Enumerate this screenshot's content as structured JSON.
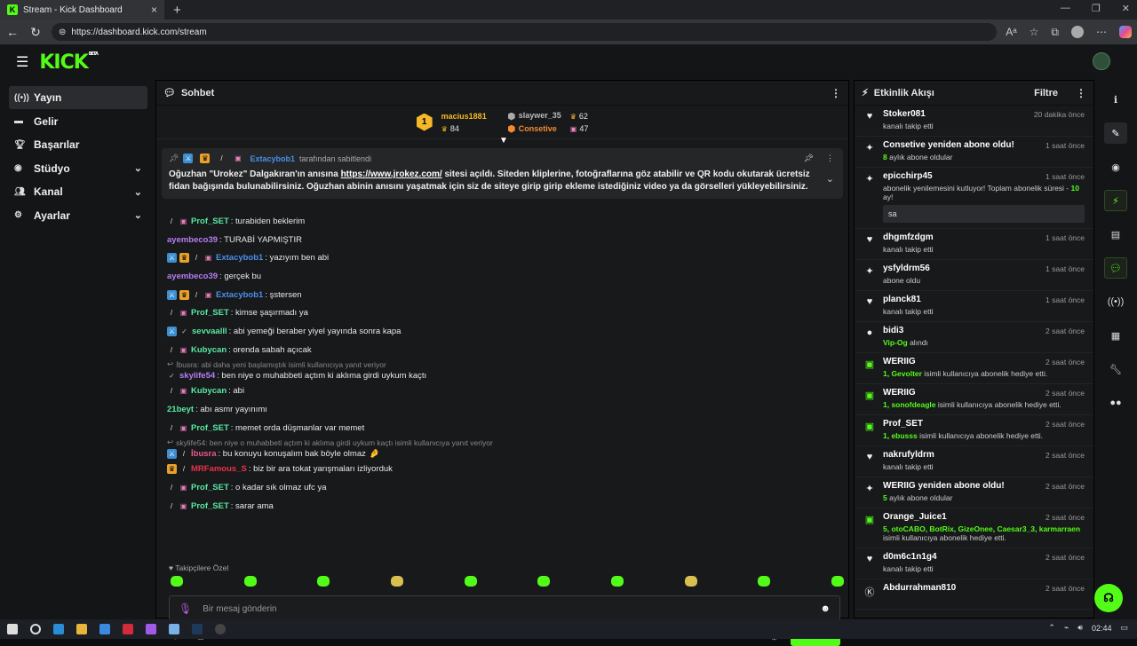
{
  "browser": {
    "tab_title": "Stream - Kick Dashboard",
    "url": "https://dashboard.kick.com/stream"
  },
  "app": {
    "logo": "KICK",
    "beta": "BETA"
  },
  "sidebar": {
    "items": [
      {
        "label": "Yayın",
        "icon": "broadcast-icon",
        "active": true
      },
      {
        "label": "Gelir",
        "icon": "money-icon"
      },
      {
        "label": "Başarılar",
        "icon": "trophy-icon"
      },
      {
        "label": "Stüdyo",
        "icon": "camera-icon",
        "chevron": true
      },
      {
        "label": "Kanal",
        "icon": "users-icon",
        "chevron": true
      },
      {
        "label": "Ayarlar",
        "icon": "gear-icon",
        "chevron": true
      }
    ]
  },
  "chat": {
    "title": "Sohbet",
    "leaderboard": {
      "first": {
        "rank": "1",
        "name": "macius1881",
        "gifts": "84"
      },
      "second": {
        "name": "slaywer_35",
        "gifts": "62"
      },
      "third": {
        "name": "Consetive",
        "gifts": "47"
      }
    },
    "pinned": {
      "pinner": "Extacybob1",
      "suffix": "tarafından sabitlendi",
      "text_before": "Oğuzhan \"Urokez\" Dalgakıran'ın anısına ",
      "link": "https://www.jrokez.com/",
      "text_after": " sitesi açıldı. Siteden kliplerine, fotoğraflarına göz atabilir ve QR kodu okutarak ücretsiz fidan bağışında bulunabilirsiniz. Oğuzhan abinin anısını yaşatmak için siz de siteye girip girip ekleme istediğiniz video ya da görselleri yükleyebilirsiniz."
    },
    "messages": [
      {
        "user": "Prof_SET",
        "color": "#58e8a2",
        "badges": [
          "sword",
          "gift"
        ],
        "text": ": turabiden beklerim"
      },
      {
        "user": "ayembeco39",
        "color": "#b57ef5",
        "badges": [],
        "text": ": TURABİ YAPMIŞTIR"
      },
      {
        "user": "Extacybob1",
        "color": "#4a8fe8",
        "badges": [
          "mod",
          "crown",
          "sword",
          "gift"
        ],
        "text": ": yazıyım ben abi"
      },
      {
        "user": "ayembeco39",
        "color": "#b57ef5",
        "badges": [],
        "text": ": gerçek bu"
      },
      {
        "user": "Extacybob1",
        "color": "#4a8fe8",
        "badges": [
          "mod",
          "crown",
          "sword",
          "gift"
        ],
        "text": ": şstersen"
      },
      {
        "user": "Prof_SET",
        "color": "#58e8a2",
        "badges": [
          "sword",
          "gift"
        ],
        "text": ": kimse şaşırmadı ya"
      },
      {
        "user": "sevvaalll",
        "color": "#58e8a2",
        "badges": [
          "mod",
          "check"
        ],
        "text": ": abi yemeği beraber yiyel yayında sonra kapa"
      },
      {
        "user": "Kubycan",
        "color": "#58e8a2",
        "badges": [
          "sword",
          "gift"
        ],
        "text": ": orenda sabah açıcak"
      },
      {
        "reply": "İbusra: abi daha yeni başlamıştık isimli kullanıcıya yanıt veriyor"
      },
      {
        "user": "skylife54",
        "color": "#b57ef5",
        "badges": [
          "check"
        ],
        "text": ": ben niye o muhabbeti açtım ki aklıma girdi uykum kaçtı"
      },
      {
        "user": "Kubycan",
        "color": "#58e8a2",
        "badges": [
          "sword",
          "gift"
        ],
        "text": ": abi"
      },
      {
        "user": "21beyt",
        "color": "#58e8a2",
        "badges": [],
        "text": ": abı asmr yayınımı"
      },
      {
        "user": "Prof_SET",
        "color": "#58e8a2",
        "badges": [
          "sword",
          "gift"
        ],
        "text": ": memet orda düşmanlar var memet"
      },
      {
        "reply": "skylife54: ben niye o muhabbeti açtım ki aklıma girdi uykum kaçtı isimli kullanıcıya yanıt veriyor"
      },
      {
        "user": "İbusra",
        "color": "#e85a86",
        "badges": [
          "mod",
          "sword"
        ],
        "text": ": bu konuyu konuşalım bak böyle olmaz",
        "emoji": "🤌"
      },
      {
        "user": "MRFamous_S",
        "color": "#e8324a",
        "badges": [
          "crown",
          "sword"
        ],
        "text": ": biz bir ara tokat yarışmaları izliyorduk"
      },
      {
        "user": "Prof_SET",
        "color": "#58e8a2",
        "badges": [
          "sword",
          "gift"
        ],
        "text": ": o kadar sık olmaz ufc ya"
      },
      {
        "user": "Prof_SET",
        "color": "#58e8a2",
        "badges": [
          "sword",
          "gift"
        ],
        "text": ": sarar ama"
      }
    ],
    "followers_only": "♥ Takipçilere Özel",
    "input_placeholder": "Bir mesaj gönderin",
    "send_label": "Gönder"
  },
  "activity": {
    "title": "Etkinlik Akışı",
    "filter_label": "Filtre",
    "events": [
      {
        "icon": "heart",
        "name": "Stoker081",
        "time": "20 dakika önce",
        "desc": "kanalı takip etti"
      },
      {
        "icon": "star",
        "name": "Consetive yeniden abone oldu!",
        "time": "1 saat önce",
        "highlight": "8",
        "desc": " aylık abone oldular"
      },
      {
        "icon": "star",
        "name": "epicchirp45",
        "time": "1 saat önce",
        "desc": "abonelik yenilemesini kutluyor! Toplam abonelik süresi - ",
        "highlight_after": "10",
        "desc2": " ay!",
        "message": "sa"
      },
      {
        "icon": "heart",
        "name": "dhgmfzdgm",
        "time": "1 saat önce",
        "desc": "kanalı takip etti"
      },
      {
        "icon": "star",
        "name": "ysfyldrm56",
        "time": "1 saat önce",
        "desc": "abone oldu"
      },
      {
        "icon": "heart",
        "name": "planck81",
        "time": "1 saat önce",
        "desc": "kanalı takip etti"
      },
      {
        "icon": "dots",
        "name": "bidi3",
        "time": "2 saat önce",
        "highlight": "Vip-Og",
        "desc": " alındı"
      },
      {
        "icon": "gift",
        "name": "WERIIG",
        "time": "2 saat önce",
        "highlight": "1, Gevolter",
        "desc": " isimli kullanıcıya abonelik hediye etti."
      },
      {
        "icon": "gift",
        "name": "WERIIG",
        "time": "2 saat önce",
        "highlight": "1, sonofdeagle",
        "desc": " isimli kullanıcıya abonelik hediye etti."
      },
      {
        "icon": "gift",
        "name": "Prof_SET",
        "time": "2 saat önce",
        "highlight": "1, ebusss",
        "desc": " isimli kullanıcıya abonelik hediye etti."
      },
      {
        "icon": "heart",
        "name": "nakrufyldrm",
        "time": "2 saat önce",
        "desc": "kanalı takip etti"
      },
      {
        "icon": "star",
        "name": "WERIIG yeniden abone oldu!",
        "time": "2 saat önce",
        "highlight": "5",
        "desc": " aylık abone oldular"
      },
      {
        "icon": "gift",
        "name": "Orange_Juice1",
        "time": "2 saat önce",
        "highlight": "5, otoCABO, BotRix, GizeOnee, Caesar3_3, karmarraen",
        "desc": " isimli kullanıcıya abonelik hediye etti."
      },
      {
        "icon": "heart",
        "name": "d0m6c1n1g4",
        "time": "2 saat önce",
        "desc": "kanalı takip etti"
      },
      {
        "icon": "kick",
        "name": "Abdurrahman810",
        "time": "2 saat önce",
        "desc": ""
      }
    ]
  },
  "taskbar": {
    "time": "02:44"
  }
}
